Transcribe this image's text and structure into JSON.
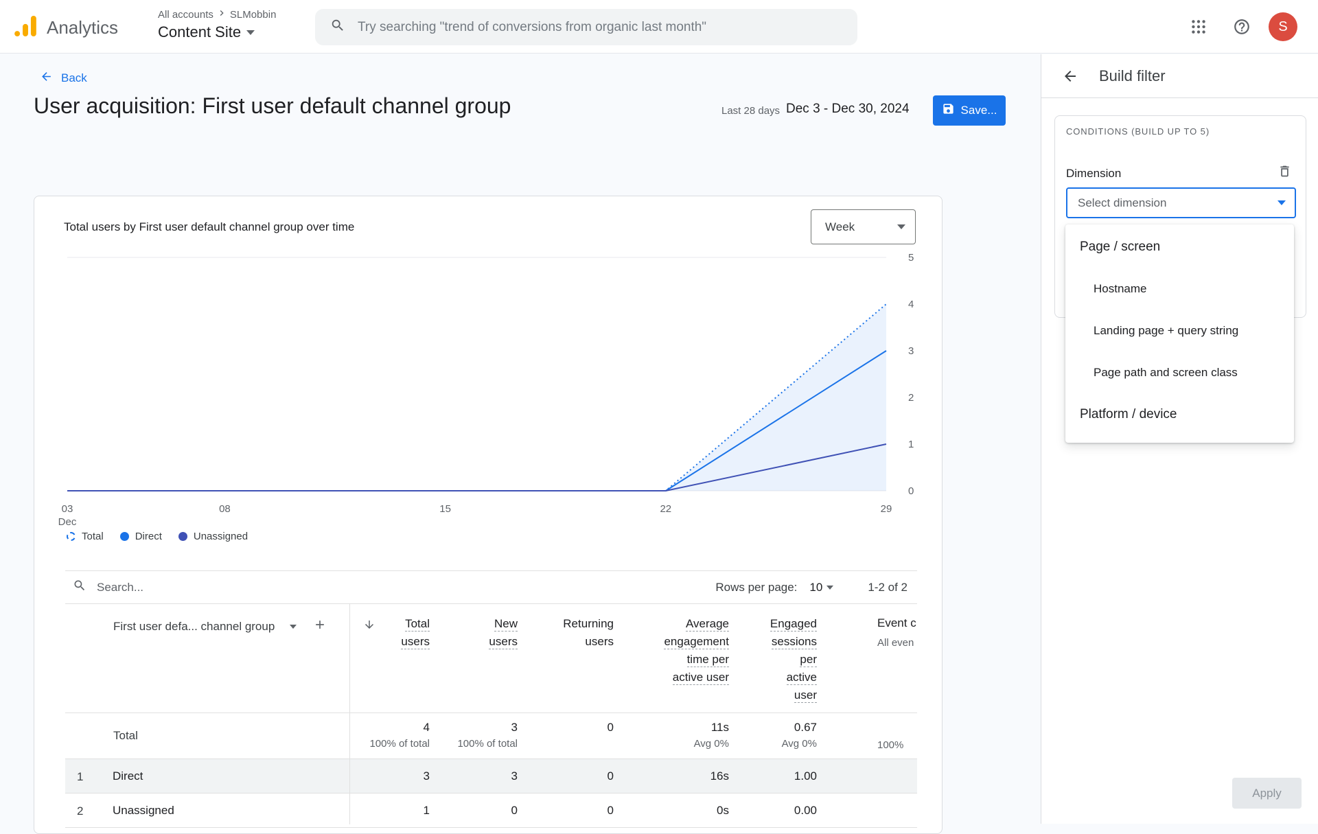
{
  "topbar": {
    "product_name": "Analytics",
    "breadcrumb_account": "All accounts",
    "breadcrumb_org": "SLMobbin",
    "property_name": "Content Site",
    "search_placeholder": "Try searching \"trend of conversions from organic last month\"",
    "avatar_initial": "S"
  },
  "report_header": {
    "back_label": "Back",
    "title": "User acquisition: First user default channel group",
    "date_preset": "Last 28 days",
    "date_range": "Dec 3 - Dec 30, 2024",
    "save_label": "Save..."
  },
  "chart_card": {
    "title": "Total users by First user default channel group over time",
    "granularity_value": "Week"
  },
  "chart_data": {
    "type": "line",
    "title": "Total users by First user default channel group over time",
    "granularity": "Week",
    "x_unit": "days since Dec 3, 2024",
    "x_domain": [
      0,
      26
    ],
    "x_ticks": [
      {
        "x": 0,
        "lines": [
          "03",
          "Dec"
        ]
      },
      {
        "x": 5,
        "lines": [
          "08"
        ]
      },
      {
        "x": 12,
        "lines": [
          "15"
        ]
      },
      {
        "x": 19,
        "lines": [
          "22"
        ]
      },
      {
        "x": 26,
        "lines": [
          "29"
        ]
      }
    ],
    "ylim": [
      0,
      5
    ],
    "y_ticks": [
      0,
      1,
      2,
      3,
      4,
      5
    ],
    "y_axis_side": "right",
    "legend_position": "bottom-left",
    "grid": "minimal",
    "series": [
      {
        "name": "Total",
        "color": "#1a73e8",
        "dash": "dotted",
        "area_fill": true,
        "points": [
          {
            "x": 0,
            "y": 0
          },
          {
            "x": 5,
            "y": 0
          },
          {
            "x": 12,
            "y": 0
          },
          {
            "x": 19,
            "y": 0
          },
          {
            "x": 26,
            "y": 4
          }
        ]
      },
      {
        "name": "Direct",
        "color": "#1a73e8",
        "dash": "solid",
        "points": [
          {
            "x": 0,
            "y": 0
          },
          {
            "x": 5,
            "y": 0
          },
          {
            "x": 12,
            "y": 0
          },
          {
            "x": 19,
            "y": 0
          },
          {
            "x": 26,
            "y": 3
          }
        ]
      },
      {
        "name": "Unassigned",
        "color": "#3f51b5",
        "dash": "solid",
        "points": [
          {
            "x": 0,
            "y": 0
          },
          {
            "x": 5,
            "y": 0
          },
          {
            "x": 12,
            "y": 0
          },
          {
            "x": 19,
            "y": 0
          },
          {
            "x": 26,
            "y": 1
          }
        ]
      }
    ]
  },
  "table": {
    "search_placeholder": "Search...",
    "rows_per_page_label": "Rows per page:",
    "rows_per_page_value": "10",
    "pagination_status": "1-2 of 2",
    "dimension_column_header": "First user defa... channel group",
    "columns": [
      {
        "lines": [
          "Total",
          "users"
        ]
      },
      {
        "lines": [
          "New",
          "users"
        ]
      },
      {
        "lines": [
          "Returning",
          "users"
        ]
      },
      {
        "lines": [
          "Average",
          "engagement",
          "time per",
          "active user"
        ]
      },
      {
        "lines": [
          "Engaged",
          "sessions",
          "per",
          "active",
          "user"
        ]
      },
      {
        "label": "Event c",
        "sublabel": "All even"
      }
    ],
    "totals": {
      "label": "Total",
      "values": [
        "4",
        "3",
        "0",
        "11s",
        "0.67"
      ],
      "subvalues": [
        "100% of total",
        "100% of total",
        "",
        "Avg 0%",
        "Avg 0%"
      ],
      "event_sub": "100%"
    },
    "rows": [
      {
        "index": "1",
        "name": "Direct",
        "values": [
          "3",
          "3",
          "0",
          "16s",
          "1.00"
        ]
      },
      {
        "index": "2",
        "name": "Unassigned",
        "values": [
          "1",
          "0",
          "0",
          "0s",
          "0.00"
        ]
      }
    ]
  },
  "filter_panel": {
    "title": "Build filter",
    "conditions_label": "CONDITIONS (BUILD UP TO 5)",
    "dimension_label": "Dimension",
    "select_placeholder": "Select dimension",
    "dropdown_options": [
      {
        "label": "Page / screen",
        "kind": "group"
      },
      {
        "label": "Hostname",
        "kind": "item"
      },
      {
        "label": "Landing page + query string",
        "kind": "item"
      },
      {
        "label": "Page path and screen class",
        "kind": "item"
      },
      {
        "label": "Platform / device",
        "kind": "group"
      }
    ],
    "apply_label": "Apply"
  },
  "colors": {
    "accent_blue": "#1a73e8",
    "unassigned_series": "#3f51b5",
    "logo_orange": "#f9ab00",
    "avatar_bg": "#db4c3f",
    "page_background": "#f8fafd"
  }
}
